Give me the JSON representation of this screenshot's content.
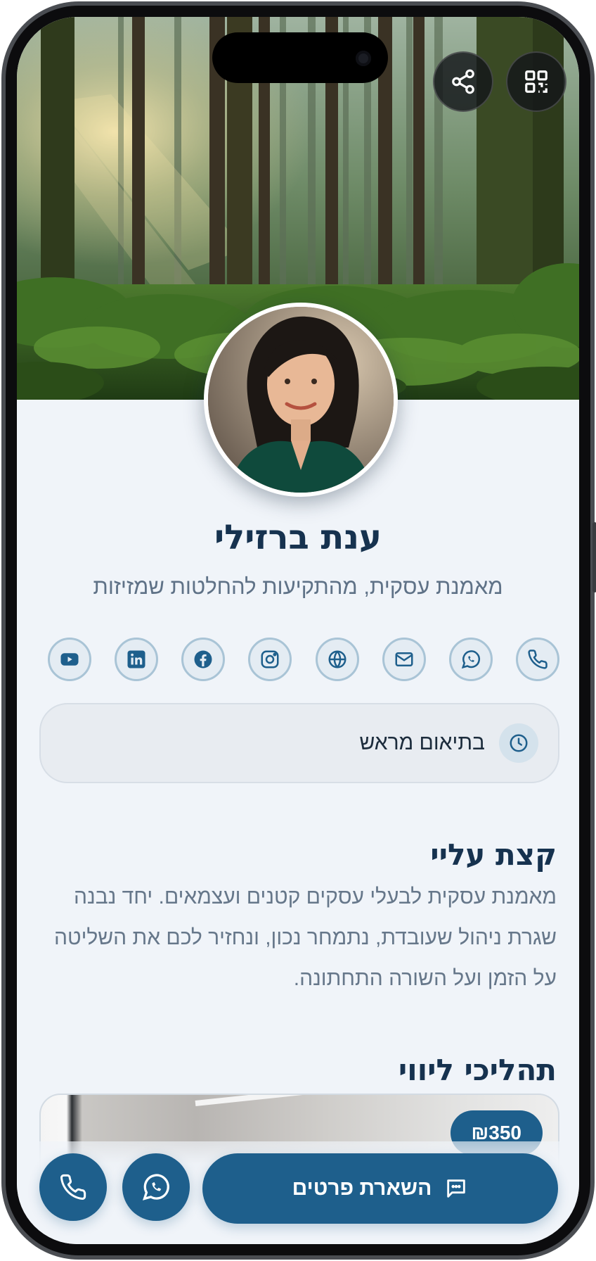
{
  "profile": {
    "name": "ענת ברזילי",
    "tagline": "מאמנת עסקית, מהתקיעות להחלטות שמזיזות"
  },
  "header": {
    "share_icon": "share-icon",
    "qr_icon": "qr-code-icon"
  },
  "socials": [
    {
      "name": "phone",
      "icon": "phone-icon"
    },
    {
      "name": "whatsapp",
      "icon": "whatsapp-icon"
    },
    {
      "name": "email",
      "icon": "mail-icon"
    },
    {
      "name": "website",
      "icon": "globe-icon"
    },
    {
      "name": "instagram",
      "icon": "instagram-icon"
    },
    {
      "name": "facebook",
      "icon": "facebook-icon"
    },
    {
      "name": "linkedin",
      "icon": "linkedin-icon"
    },
    {
      "name": "youtube",
      "icon": "youtube-icon"
    }
  ],
  "hours": {
    "text": "בתיאום מראש"
  },
  "about": {
    "title": "קצת עליי",
    "text": "מאמנת עסקית לבעלי עסקים קטנים ועצמאים. יחד נבנה שגרת ניהול שעובדת, נתמחר נכון, ונחזיר לכם את השליטה על הזמן ועל השורה התחתונה."
  },
  "services": {
    "title": "תהליכי ליווי",
    "first_price": "₪350"
  },
  "bottom_bar": {
    "cta_label": "השארת פרטים"
  },
  "colors": {
    "primary": "#1e5f8c",
    "heading": "#16324f",
    "background": "#f0f4f9"
  }
}
